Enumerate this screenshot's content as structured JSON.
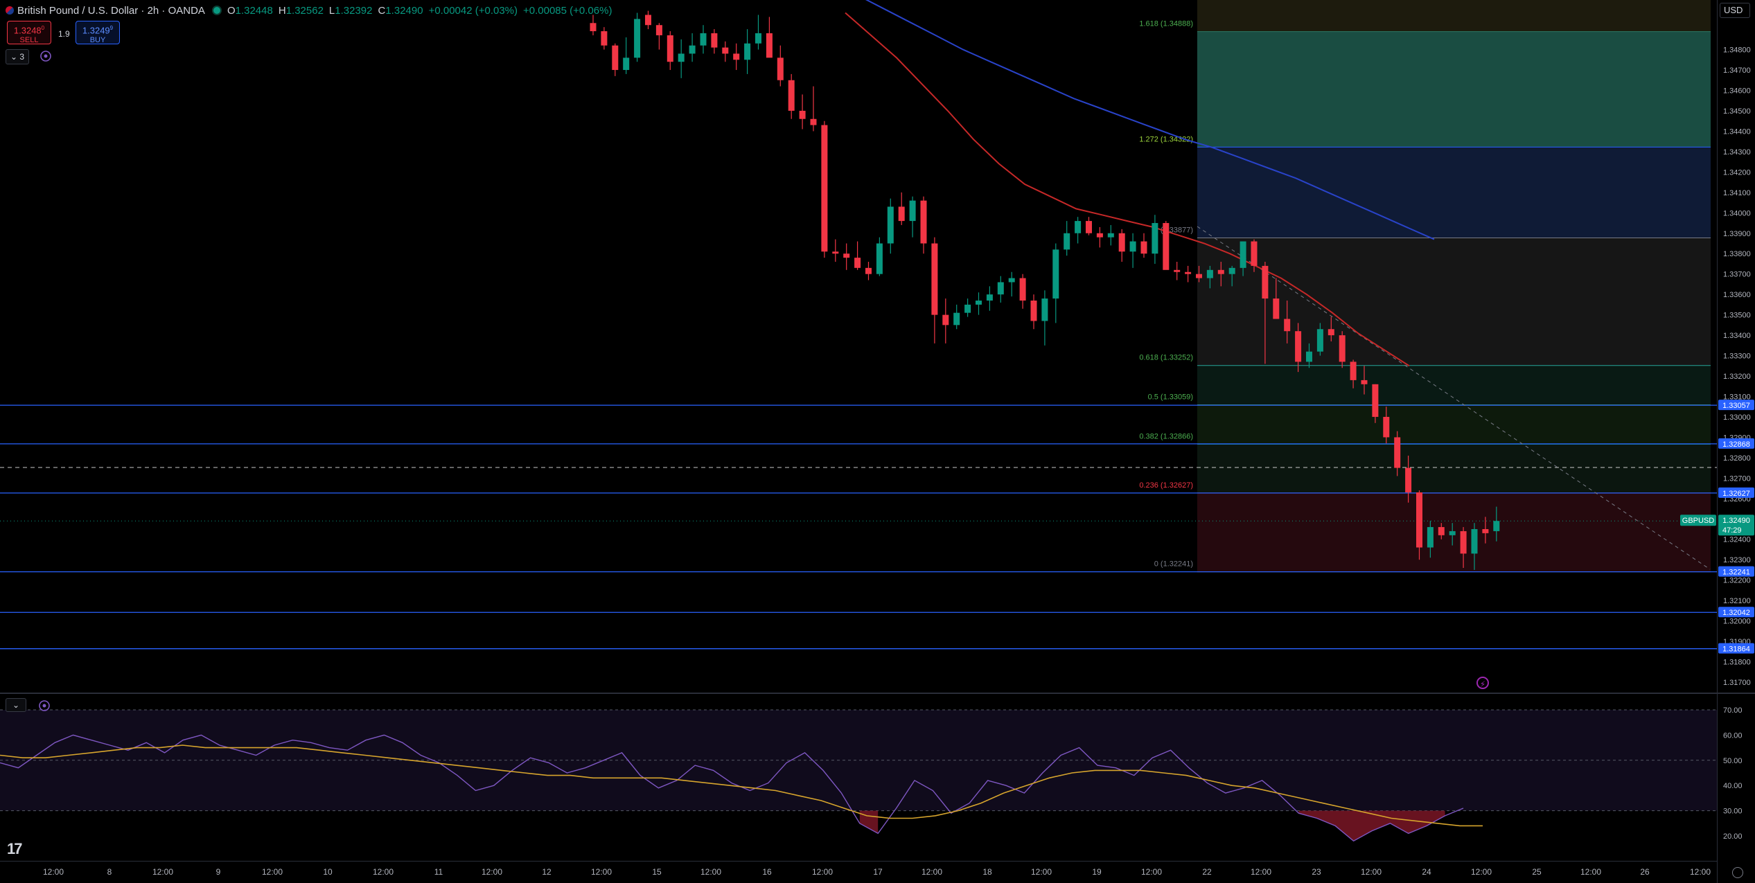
{
  "header": {
    "symbol_title": "British Pound / U.S. Dollar · 2h · OANDA",
    "ohlc": [
      {
        "k": "O",
        "v": "1.32448"
      },
      {
        "k": "H",
        "v": "1.32562"
      },
      {
        "k": "L",
        "v": "1.32392"
      },
      {
        "k": "C",
        "v": "1.32490"
      }
    ],
    "change": "+0.00042 (+0.03%)",
    "change2": "+0.00085 (+0.06%)"
  },
  "trade": {
    "sell_price": "1.3248",
    "sell_sup": "0",
    "sell_label": "SELL",
    "spread": "1.9",
    "buy_price": "1.3249",
    "buy_sup": "9",
    "buy_label": "BUY"
  },
  "indicator_count": "3",
  "currency": "USD",
  "icons": {
    "collapse": "chevron-down-icon",
    "visibility": "eye-circle-icon",
    "lightning": "lightning-icon",
    "settings": "gear-icon",
    "logo": "tradingview-logo"
  },
  "colors": {
    "up": "#089981",
    "down": "#f23645",
    "ema_blue": "#2943c9",
    "ema_red": "#c62828",
    "rsi": "#7e57c2",
    "rsi_ma": "#d7a52d",
    "hline": "#2962ff"
  },
  "price_axis": {
    "ticks": [
      "1.34800",
      "1.34700",
      "1.34600",
      "1.34500",
      "1.34400",
      "1.34300",
      "1.34200",
      "1.34100",
      "1.34000",
      "1.33900",
      "1.33800",
      "1.33700",
      "1.33600",
      "1.33500",
      "1.33400",
      "1.33300",
      "1.33200",
      "1.33100",
      "1.33000",
      "1.32900",
      "1.32800",
      "1.32700",
      "1.32600",
      "1.32500",
      "1.32400",
      "1.32300",
      "1.32200",
      "1.32100",
      "1.32000",
      "1.31900",
      "1.31800",
      "1.31700"
    ],
    "labels": [
      {
        "text": "1.33057",
        "price": 1.33057
      },
      {
        "text": "1.32868",
        "price": 1.32868
      },
      {
        "text": "1.32627",
        "price": 1.32627
      },
      {
        "text": "1.32241",
        "price": 1.32241
      },
      {
        "text": "1.32042",
        "price": 1.32042
      },
      {
        "text": "1.31864",
        "price": 1.31864
      }
    ],
    "current": {
      "symbol": "GBPUSD",
      "price": "1.32490",
      "countdown": "47:29"
    }
  },
  "fib": {
    "levels": [
      {
        "ratio": 1.618,
        "text": "1.618 (1.34888)",
        "price": 1.34888,
        "color": "#1e5a4d"
      },
      {
        "ratio": 1.272,
        "text": "1.272 (1.34322)",
        "price": 1.34322,
        "color": "#12203f"
      },
      {
        "ratio": 1,
        "text": "1 (1.33877)",
        "price": 1.33877,
        "color": "#1a1a1a"
      },
      {
        "ratio": 0.618,
        "text": "0.618 (1.33252)",
        "price": 1.33252,
        "color": "#0b1f18"
      },
      {
        "ratio": 0.5,
        "text": "0.5 (1.33059)",
        "price": 1.33059,
        "color": "#0f1e0e"
      },
      {
        "ratio": 0.382,
        "text": "0.382 (1.32866)",
        "price": 1.32866,
        "color": "#0d1a12"
      },
      {
        "ratio": 0.236,
        "text": "0.236 (1.32627)",
        "price": 1.32627,
        "color": "#2b0b10"
      },
      {
        "ratio": 0,
        "text": "0 (1.32241)",
        "price": 1.32241,
        "color": "#2b0b10"
      }
    ]
  },
  "rsi_axis": [
    "70.00",
    "60.00",
    "50.00",
    "40.00",
    "30.00",
    "20.00"
  ],
  "time_axis": [
    "12:00",
    "8",
    "12:00",
    "9",
    "12:00",
    "10",
    "12:00",
    "11",
    "12:00",
    "12",
    "12:00",
    "15",
    "12:00",
    "16",
    "12:00",
    "17",
    "12:00",
    "18",
    "12:00",
    "19",
    "12:00",
    "22",
    "12:00",
    "23",
    "12:00",
    "24",
    "12:00",
    "25",
    "12:00",
    "26",
    "12:00"
  ],
  "chart_data": {
    "type": "candlestick",
    "title": "British Pound / U.S. Dollar · 2h · OANDA",
    "ylim": [
      1.3165,
      1.3495
    ],
    "candles": [
      [
        1.3493,
        1.3497,
        1.3487,
        1.3489
      ],
      [
        1.3489,
        1.3491,
        1.348,
        1.3482
      ],
      [
        1.3482,
        1.3483,
        1.3467,
        1.347
      ],
      [
        1.347,
        1.3486,
        1.3468,
        1.3476
      ],
      [
        1.3476,
        1.3498,
        1.3474,
        1.3495
      ],
      [
        1.3497,
        1.3499,
        1.349,
        1.3492
      ],
      [
        1.3492,
        1.3493,
        1.348,
        1.3487
      ],
      [
        1.3487,
        1.3489,
        1.347,
        1.3474
      ],
      [
        1.3474,
        1.3485,
        1.3466,
        1.3478
      ],
      [
        1.3478,
        1.3488,
        1.3474,
        1.3482
      ],
      [
        1.3482,
        1.3492,
        1.3478,
        1.3488
      ],
      [
        1.3488,
        1.349,
        1.3478,
        1.3481
      ],
      [
        1.3481,
        1.3484,
        1.3474,
        1.3478
      ],
      [
        1.3478,
        1.3483,
        1.347,
        1.3475
      ],
      [
        1.3475,
        1.349,
        1.3468,
        1.3483
      ],
      [
        1.3483,
        1.3497,
        1.348,
        1.3488
      ],
      [
        1.3488,
        1.3496,
        1.348,
        1.3476
      ],
      [
        1.3476,
        1.3482,
        1.3462,
        1.3465
      ],
      [
        1.3465,
        1.3468,
        1.3446,
        1.345
      ],
      [
        1.345,
        1.3458,
        1.3441,
        1.3446
      ],
      [
        1.3446,
        1.3462,
        1.344,
        1.3443
      ],
      [
        1.3443,
        1.3445,
        1.3378,
        1.3381
      ],
      [
        1.3381,
        1.3387,
        1.3376,
        1.338
      ],
      [
        1.338,
        1.3385,
        1.3372,
        1.3378
      ],
      [
        1.3378,
        1.3386,
        1.3372,
        1.3373
      ],
      [
        1.3373,
        1.3376,
        1.3367,
        1.337
      ],
      [
        1.337,
        1.3388,
        1.3369,
        1.3385
      ],
      [
        1.3385,
        1.3407,
        1.338,
        1.3403
      ],
      [
        1.3403,
        1.341,
        1.3394,
        1.3396
      ],
      [
        1.3396,
        1.3408,
        1.3388,
        1.3406
      ],
      [
        1.3406,
        1.3408,
        1.338,
        1.3385
      ],
      [
        1.3385,
        1.3388,
        1.3336,
        1.335
      ],
      [
        1.335,
        1.3358,
        1.3336,
        1.3345
      ],
      [
        1.3345,
        1.3355,
        1.3343,
        1.3351
      ],
      [
        1.3351,
        1.3358,
        1.3349,
        1.3355
      ],
      [
        1.3355,
        1.3361,
        1.335,
        1.3357
      ],
      [
        1.3357,
        1.3364,
        1.3352,
        1.336
      ],
      [
        1.336,
        1.3369,
        1.3356,
        1.3366
      ],
      [
        1.3366,
        1.3371,
        1.3359,
        1.3368
      ],
      [
        1.3368,
        1.337,
        1.3353,
        1.3357
      ],
      [
        1.3357,
        1.336,
        1.3343,
        1.3347
      ],
      [
        1.3347,
        1.3362,
        1.3335,
        1.3358
      ],
      [
        1.3358,
        1.3385,
        1.3346,
        1.3382
      ],
      [
        1.3382,
        1.3396,
        1.3379,
        1.339
      ],
      [
        1.339,
        1.3398,
        1.3385,
        1.3396
      ],
      [
        1.3396,
        1.3398,
        1.3389,
        1.339
      ],
      [
        1.339,
        1.3393,
        1.3383,
        1.3388
      ],
      [
        1.3388,
        1.3394,
        1.3384,
        1.339
      ],
      [
        1.339,
        1.3392,
        1.3376,
        1.3381
      ],
      [
        1.3381,
        1.339,
        1.3373,
        1.3386
      ],
      [
        1.3386,
        1.339,
        1.3378,
        1.338
      ],
      [
        1.338,
        1.3399,
        1.3375,
        1.3395
      ],
      [
        1.3395,
        1.3396,
        1.3378,
        1.3372
      ],
      [
        1.3372,
        1.3376,
        1.3367,
        1.3371
      ],
      [
        1.3371,
        1.3374,
        1.3366,
        1.337
      ],
      [
        1.337,
        1.3374,
        1.3366,
        1.3368
      ],
      [
        1.3368,
        1.3374,
        1.3363,
        1.3372
      ],
      [
        1.3372,
        1.3376,
        1.3364,
        1.337
      ],
      [
        1.337,
        1.3374,
        1.3364,
        1.3373
      ],
      [
        1.3373,
        1.3386,
        1.3369,
        1.3386
      ],
      [
        1.3386,
        1.3387,
        1.3371,
        1.3374
      ],
      [
        1.3374,
        1.3376,
        1.3326,
        1.3358
      ],
      [
        1.3358,
        1.3368,
        1.3352,
        1.3348
      ],
      [
        1.3348,
        1.3357,
        1.3336,
        1.3342
      ],
      [
        1.3342,
        1.3346,
        1.3322,
        1.3327
      ],
      [
        1.3327,
        1.3336,
        1.3324,
        1.3332
      ],
      [
        1.3332,
        1.3346,
        1.333,
        1.3343
      ],
      [
        1.3343,
        1.3349,
        1.3337,
        1.334
      ],
      [
        1.334,
        1.3342,
        1.3324,
        1.3327
      ],
      [
        1.3327,
        1.3328,
        1.3314,
        1.3318
      ],
      [
        1.3318,
        1.3325,
        1.3311,
        1.3316
      ],
      [
        1.3316,
        1.3316,
        1.3297,
        1.33
      ],
      [
        1.33,
        1.3305,
        1.3287,
        1.329
      ],
      [
        1.329,
        1.3293,
        1.3271,
        1.3275
      ],
      [
        1.3275,
        1.3281,
        1.3258,
        1.3263
      ],
      [
        1.3263,
        1.3264,
        1.323,
        1.3236
      ],
      [
        1.3236,
        1.3249,
        1.3231,
        1.3246
      ],
      [
        1.3246,
        1.3248,
        1.324,
        1.3242
      ],
      [
        1.3242,
        1.3248,
        1.3237,
        1.3244
      ],
      [
        1.3244,
        1.3246,
        1.3226,
        1.3233
      ],
      [
        1.3233,
        1.3248,
        1.3225,
        1.3245
      ],
      [
        1.3245,
        1.3251,
        1.3238,
        1.3243
      ],
      [
        1.3244,
        1.3256,
        1.3239,
        1.3249
      ]
    ],
    "ema_blue": [
      1.3508,
      1.3501,
      1.3494,
      1.3487,
      1.348,
      1.3474,
      1.3468,
      1.3462,
      1.3456,
      1.3451,
      1.3446,
      1.3441,
      1.3436,
      1.3432,
      1.3427,
      1.3422,
      1.3417,
      1.3411,
      1.3405,
      1.3399,
      1.3393,
      1.3387
    ],
    "ema_red": [
      1.3498,
      1.3487,
      1.3476,
      1.3463,
      1.345,
      1.3436,
      1.3424,
      1.3414,
      1.3408,
      1.3402,
      1.3399,
      1.3396,
      1.3393,
      1.3389,
      1.3385,
      1.338,
      1.3374,
      1.3368,
      1.336,
      1.3351,
      1.3341,
      1.3333,
      1.3325
    ],
    "rsi": [
      49,
      47,
      52,
      57,
      60,
      58,
      56,
      54,
      57,
      53,
      58,
      60,
      56,
      54,
      52,
      56,
      58,
      57,
      55,
      54,
      58,
      60,
      57,
      52,
      49,
      44,
      38,
      40,
      46,
      51,
      49,
      45,
      47,
      50,
      53,
      44,
      39,
      42,
      48,
      46,
      41,
      38,
      41,
      49,
      53,
      46,
      37,
      25,
      21,
      31,
      42,
      38,
      29,
      33,
      42,
      40,
      37,
      45,
      52,
      55,
      48,
      47,
      44,
      51,
      54,
      47,
      41,
      37,
      39,
      42,
      36,
      29,
      27,
      24,
      18,
      22,
      25,
      21,
      24,
      28,
      31
    ],
    "rsi_ma": [
      52,
      51,
      51,
      52,
      53,
      54,
      55,
      55,
      56,
      55,
      55,
      55,
      55,
      55,
      54,
      53,
      52,
      51,
      50,
      49,
      48,
      47,
      46,
      45,
      44,
      44,
      43,
      43,
      43,
      43,
      42,
      41,
      40,
      39,
      38,
      36,
      34,
      31,
      28,
      27,
      27,
      28,
      30,
      33,
      37,
      40,
      43,
      45,
      46,
      46,
      46,
      45,
      44,
      42,
      40,
      39,
      37,
      35,
      33,
      31,
      29,
      27,
      26,
      25,
      24,
      24
    ],
    "rsi_levels": {
      "upper": 70,
      "mid": 50,
      "lower": 30
    }
  }
}
